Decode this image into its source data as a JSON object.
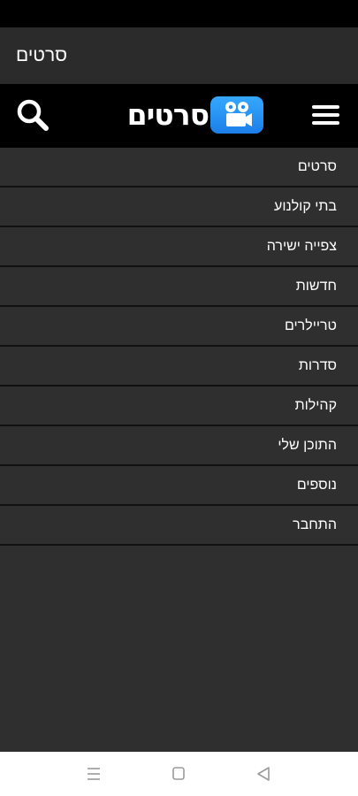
{
  "app_title": "סרטים",
  "header": {
    "logo_text": "סרטים",
    "logo_icon": "movie-camera-icon",
    "search_icon": "search-icon",
    "menu_icon": "hamburger-menu-icon"
  },
  "menu": {
    "items": [
      {
        "label": "סרטים"
      },
      {
        "label": "בתי קולנוע"
      },
      {
        "label": "צפייה ישירה"
      },
      {
        "label": "חדשות"
      },
      {
        "label": "טריילרים"
      },
      {
        "label": "סדרות"
      },
      {
        "label": "קהילות"
      },
      {
        "label": "התוכן שלי"
      },
      {
        "label": "נוספים"
      },
      {
        "label": "התחבר"
      }
    ]
  },
  "nav_bar": {
    "icons": [
      "recent-apps-icon",
      "home-icon",
      "back-icon"
    ]
  },
  "colors": {
    "status_bar": "#000000",
    "title_bar": "#2b2b2b",
    "header": "#000000",
    "menu_bg": "#2f2f2f",
    "divider": "#111111",
    "logo_blue": "#1f8cf0",
    "nav_bar": "#ffffff"
  }
}
